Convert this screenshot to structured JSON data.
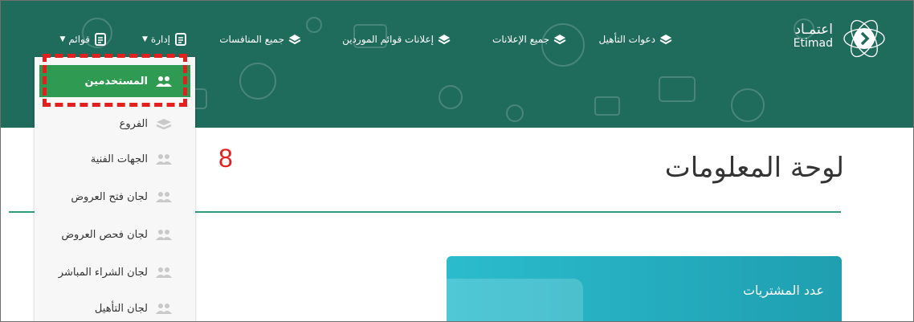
{
  "nav": {
    "items": [
      {
        "label": "دعوات التأهيل",
        "icon": "layers-icon",
        "caret": false
      },
      {
        "label": "جميع الإعلانات",
        "icon": "layers-icon",
        "caret": false
      },
      {
        "label": "إعلانات قوائم الموردين",
        "icon": "layers-icon",
        "caret": false
      },
      {
        "label": "جميع المنافسات",
        "icon": "layers-icon",
        "caret": false
      },
      {
        "label": "إدارة",
        "icon": "document-icon",
        "caret": true
      },
      {
        "label": "قوائم",
        "icon": "document-icon",
        "caret": true
      }
    ]
  },
  "logo": {
    "arabic": "اعتمـاد",
    "english": "Etimad"
  },
  "dropdown": {
    "items": [
      {
        "label": "المستخدمين",
        "icon": "users-icon",
        "active": true
      },
      {
        "label": "الفروع",
        "icon": "layers-icon",
        "active": false
      },
      {
        "label": "الجهات الفنية",
        "icon": "users-icon",
        "active": false
      },
      {
        "label": "لجان فتح العروض",
        "icon": "users-icon",
        "active": false
      },
      {
        "label": "لجان فحص العروض",
        "icon": "users-icon",
        "active": false
      },
      {
        "label": "لجان الشراء المباشر",
        "icon": "users-icon",
        "active": false
      },
      {
        "label": "لجان التأهيل",
        "icon": "users-icon",
        "active": false
      }
    ]
  },
  "annotation": {
    "step_number": "8"
  },
  "page": {
    "title": "لوحة المعلومات"
  },
  "card": {
    "label": "عدد المشتريات"
  },
  "colors": {
    "topbar": "#1f6b5c",
    "active": "#2e9a52",
    "highlight": "#e3201e",
    "card": "#2abccd"
  }
}
